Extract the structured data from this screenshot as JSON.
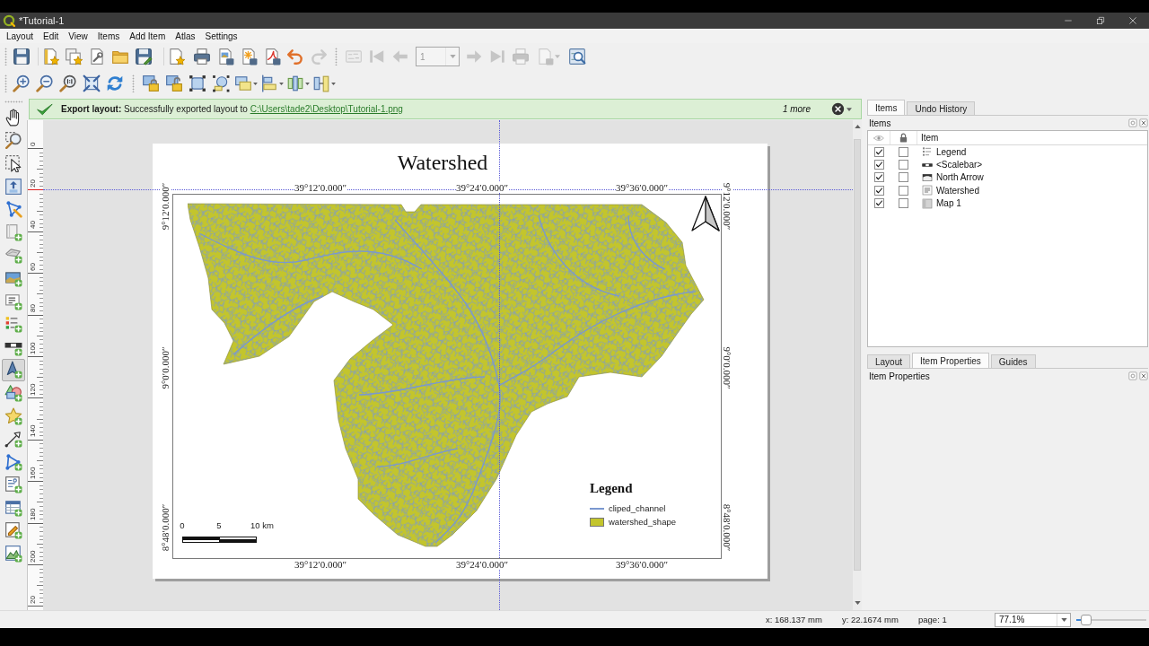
{
  "window": {
    "title": "*Tutorial-1"
  },
  "menu": [
    "Layout",
    "Edit",
    "View",
    "Items",
    "Add Item",
    "Atlas",
    "Settings"
  ],
  "main_toolbar": {
    "buttons": [
      {
        "disabled": false
      },
      {
        "disabled": false
      },
      {
        "disabled": false
      },
      {
        "disabled": false
      },
      {
        "disabled": false
      },
      {
        "disabled": false
      },
      {
        "disabled": false
      },
      {
        "disabled": false
      },
      {
        "disabled": false
      },
      {
        "disabled": false
      },
      {
        "disabled": false
      },
      {
        "disabled": false
      },
      {
        "disabled": true
      },
      {
        "disabled": true
      },
      {
        "disabled": true
      },
      {
        "disabled": true
      },
      {
        "disabled": true
      },
      {
        "disabled": true
      },
      {
        "disabled": true
      },
      {
        "disabled": true
      },
      {
        "disabled": false
      }
    ],
    "atlas_page_field": {
      "value": "1",
      "disabled": true
    }
  },
  "tools": [
    {
      "selected": false
    },
    {
      "selected": false
    },
    {
      "selected": false
    },
    {
      "selected": false
    },
    {
      "selected": false
    },
    {
      "selected": false
    },
    {
      "selected": false
    },
    {
      "selected": false
    },
    {
      "selected": false
    },
    {
      "selected": false
    },
    {
      "selected": false
    },
    {
      "selected": true
    },
    {
      "selected": false
    },
    {
      "selected": false
    },
    {
      "selected": false
    },
    {
      "selected": false
    },
    {
      "selected": false
    },
    {
      "selected": false
    },
    {
      "selected": false
    },
    {
      "selected": false
    }
  ],
  "message_bar": {
    "text": "**Export layout:** Successfully exported layout to",
    "link": "C:\\Users\\tade2\\Desktop\\Tutorial-1.png",
    "more": "1 more"
  },
  "ruler": {
    "labels": [
      "0",
      "20",
      "40",
      "60",
      "80",
      "100",
      "120",
      "140",
      "160",
      "180",
      "200",
      "20"
    ]
  },
  "layout_page": {
    "title": "Watershed",
    "grid_labels": {
      "top": [
        "39°12′0.000″",
        "39°24′0.000″",
        "39°36′0.000″"
      ],
      "bottom": [
        "39°12′0.000″",
        "39°24′0.000″",
        "39°36′0.000″"
      ],
      "left": [
        "9°12′0.000″",
        "9°0′0.000″",
        "8°48′0.000″"
      ],
      "right": [
        "9°12′0.000″",
        "9°0′0.000″",
        "8°48′0.000″"
      ]
    },
    "legend": {
      "title": "Legend",
      "items": [
        {
          "kind": "line",
          "label": "cliped_channel",
          "color": "#7a98cf"
        },
        {
          "kind": "fill",
          "label": "watershed_shape",
          "color": "#c3c52c"
        }
      ]
    },
    "scalebar": {
      "labels": [
        "0",
        "5",
        "10 km"
      ]
    }
  },
  "items_panel": {
    "tabs": [
      {
        "label": "Items",
        "selected": true
      },
      {
        "label": "Undo History",
        "selected": false
      }
    ],
    "title": "Items",
    "column": "Item",
    "rows": [
      {
        "kind": "legend",
        "name": "Legend",
        "visible": true,
        "locked": false
      },
      {
        "kind": "scalebar",
        "name": "<Scalebar>",
        "visible": true,
        "locked": false
      },
      {
        "kind": "picture",
        "name": "North Arrow",
        "visible": true,
        "locked": false
      },
      {
        "kind": "label",
        "name": "Watershed",
        "visible": true,
        "locked": false
      },
      {
        "kind": "map",
        "name": "Map 1",
        "visible": true,
        "locked": false
      }
    ]
  },
  "properties_panel": {
    "tabs": [
      {
        "label": "Layout",
        "selected": false
      },
      {
        "label": "Item Properties",
        "selected": true
      },
      {
        "label": "Guides",
        "selected": false
      }
    ],
    "title": "Item Properties"
  },
  "status_bar": {
    "x": "x: 168.137 mm",
    "y": "y: 22.1674 mm",
    "page": "page: 1",
    "zoom": "77.1%",
    "zoom_slider": {
      "level": 0.08
    }
  }
}
